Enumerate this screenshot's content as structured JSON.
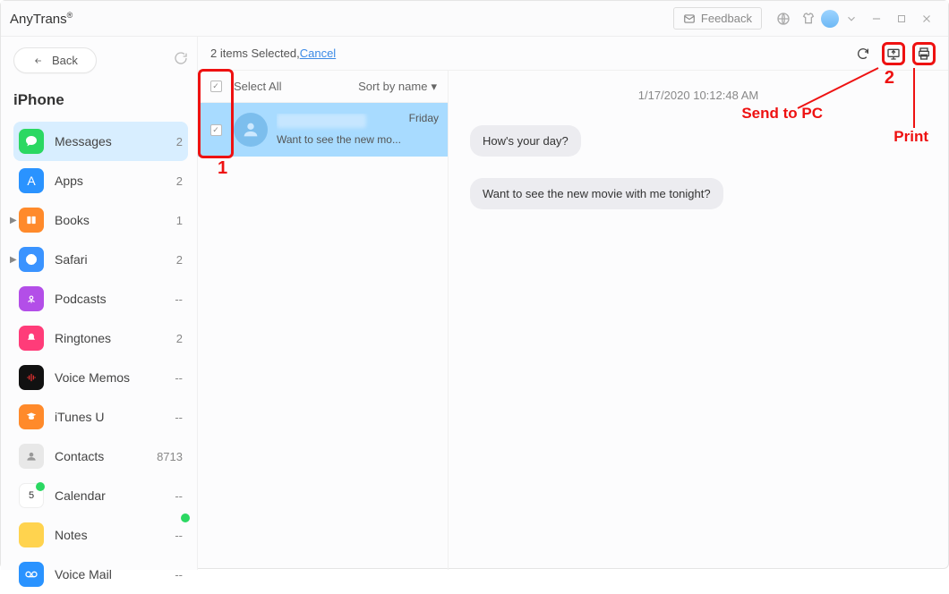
{
  "app": {
    "title": "AnyTrans",
    "reg": "®"
  },
  "titlebar": {
    "feedback": "Feedback"
  },
  "sidebar": {
    "back": "Back",
    "device": "iPhone",
    "items": [
      {
        "label": "Messages",
        "count": "2"
      },
      {
        "label": "Apps",
        "count": "2"
      },
      {
        "label": "Books",
        "count": "1"
      },
      {
        "label": "Safari",
        "count": "2"
      },
      {
        "label": "Podcasts",
        "count": "--"
      },
      {
        "label": "Ringtones",
        "count": "2"
      },
      {
        "label": "Voice Memos",
        "count": "--"
      },
      {
        "label": "iTunes U",
        "count": "--"
      },
      {
        "label": "Contacts",
        "count": "8713"
      },
      {
        "label": "Calendar",
        "count": "--"
      },
      {
        "label": "Notes",
        "count": "--"
      },
      {
        "label": "Voice Mail",
        "count": "--"
      }
    ]
  },
  "toolbar": {
    "selected_text": "2 items Selected, ",
    "cancel": "Cancel"
  },
  "list": {
    "select_all": "Select All",
    "sort": "Sort by name",
    "conversations": [
      {
        "time": "Friday",
        "preview": "Want to see the new mo..."
      }
    ]
  },
  "messages": {
    "timestamp": "1/17/2020 10:12:48 AM",
    "bubbles": [
      {
        "text": "How's your day?"
      },
      {
        "text": "Want to see the new movie with me tonight?"
      }
    ]
  },
  "annotations": {
    "one": "1",
    "two": "2",
    "send": "Send to PC",
    "print": "Print"
  }
}
